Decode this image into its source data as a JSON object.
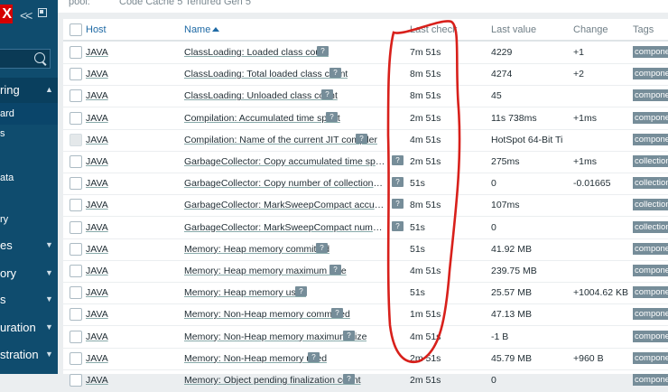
{
  "sidebar": {
    "logo": "X",
    "search_placeholder": "",
    "items": [
      {
        "label": "ring"
      },
      {
        "label": "ard"
      },
      {
        "label": "s"
      },
      {
        "label": "ata"
      },
      {
        "label": "ry"
      },
      {
        "label": "es"
      },
      {
        "label": "ory"
      },
      {
        "label": "s"
      },
      {
        "label": "uration"
      },
      {
        "label": "stration"
      }
    ]
  },
  "top": {
    "pool_label": "pool:",
    "pool_value": "Code Cache 5   Tenured Gen 5"
  },
  "table": {
    "headers": {
      "host": "Host",
      "name": "Name",
      "last_check": "Last check",
      "last_value": "Last value",
      "change": "Change",
      "tags": "Tags"
    },
    "rows": [
      {
        "host": "JAVA",
        "name": "ClassLoading: Loaded class count",
        "last_check": "7m 51s",
        "last_value": "4229",
        "change": "+1",
        "tag": "component"
      },
      {
        "host": "JAVA",
        "name": "ClassLoading: Total loaded class count",
        "last_check": "8m 51s",
        "last_value": "4274",
        "change": "+2",
        "tag": "component"
      },
      {
        "host": "JAVA",
        "name": "ClassLoading: Unloaded class count",
        "last_check": "8m 51s",
        "last_value": "45",
        "change": "",
        "tag": "component"
      },
      {
        "host": "JAVA",
        "name": "Compilation: Accumulated time spent",
        "last_check": "2m 51s",
        "last_value": "11s 738ms",
        "change": "+1ms",
        "tag": "component"
      },
      {
        "host": "JAVA",
        "name": "Compilation: Name of the current JIT compiler",
        "last_check": "4m 51s",
        "last_value": "HotSpot 64-Bit Ti…",
        "change": "",
        "tag": "component"
      },
      {
        "host": "JAVA",
        "name": "GarbageCollector: Copy accumulated time spent in c…",
        "last_check": "2m 51s",
        "last_value": "275ms",
        "change": "+1ms",
        "tag": "collection"
      },
      {
        "host": "JAVA",
        "name": "GarbageCollector: Copy number of collections per se…",
        "last_check": "51s",
        "last_value": "0",
        "change": "-0.01665",
        "tag": "collection"
      },
      {
        "host": "JAVA",
        "name": "GarbageCollector: MarkSweepCompact accumulate…",
        "last_check": "8m 51s",
        "last_value": "107ms",
        "change": "",
        "tag": "collection"
      },
      {
        "host": "JAVA",
        "name": "GarbageCollector: MarkSweepCompact number of c…",
        "last_check": "51s",
        "last_value": "0",
        "change": "",
        "tag": "collection"
      },
      {
        "host": "JAVA",
        "name": "Memory: Heap memory committed",
        "last_check": "51s",
        "last_value": "41.92 MB",
        "change": "",
        "tag": "component"
      },
      {
        "host": "JAVA",
        "name": "Memory: Heap memory maximum size",
        "last_check": "4m 51s",
        "last_value": "239.75 MB",
        "change": "",
        "tag": "component"
      },
      {
        "host": "JAVA",
        "name": "Memory: Heap memory used",
        "last_check": "51s",
        "last_value": "25.57 MB",
        "change": "+1004.62 KB",
        "tag": "component"
      },
      {
        "host": "JAVA",
        "name": "Memory: Non-Heap memory committed",
        "last_check": "1m 51s",
        "last_value": "47.13 MB",
        "change": "",
        "tag": "component"
      },
      {
        "host": "JAVA",
        "name": "Memory: Non-Heap memory maximum size",
        "last_check": "4m 51s",
        "last_value": "-1 B",
        "change": "",
        "tag": "component"
      },
      {
        "host": "JAVA",
        "name": "Memory: Non-Heap memory used",
        "last_check": "2m 51s",
        "last_value": "45.79 MB",
        "change": "+960 B",
        "tag": "component"
      },
      {
        "host": "JAVA",
        "name": "Memory: Object pending finalization count",
        "last_check": "2m 51s",
        "last_value": "0",
        "change": "",
        "tag": "component"
      }
    ]
  },
  "colors": {
    "sidebar": "#0f4c6e",
    "logo": "#d40000",
    "link": "#1f6aa5",
    "annotation": "#d8201b",
    "tag_bg": "#768d99"
  }
}
